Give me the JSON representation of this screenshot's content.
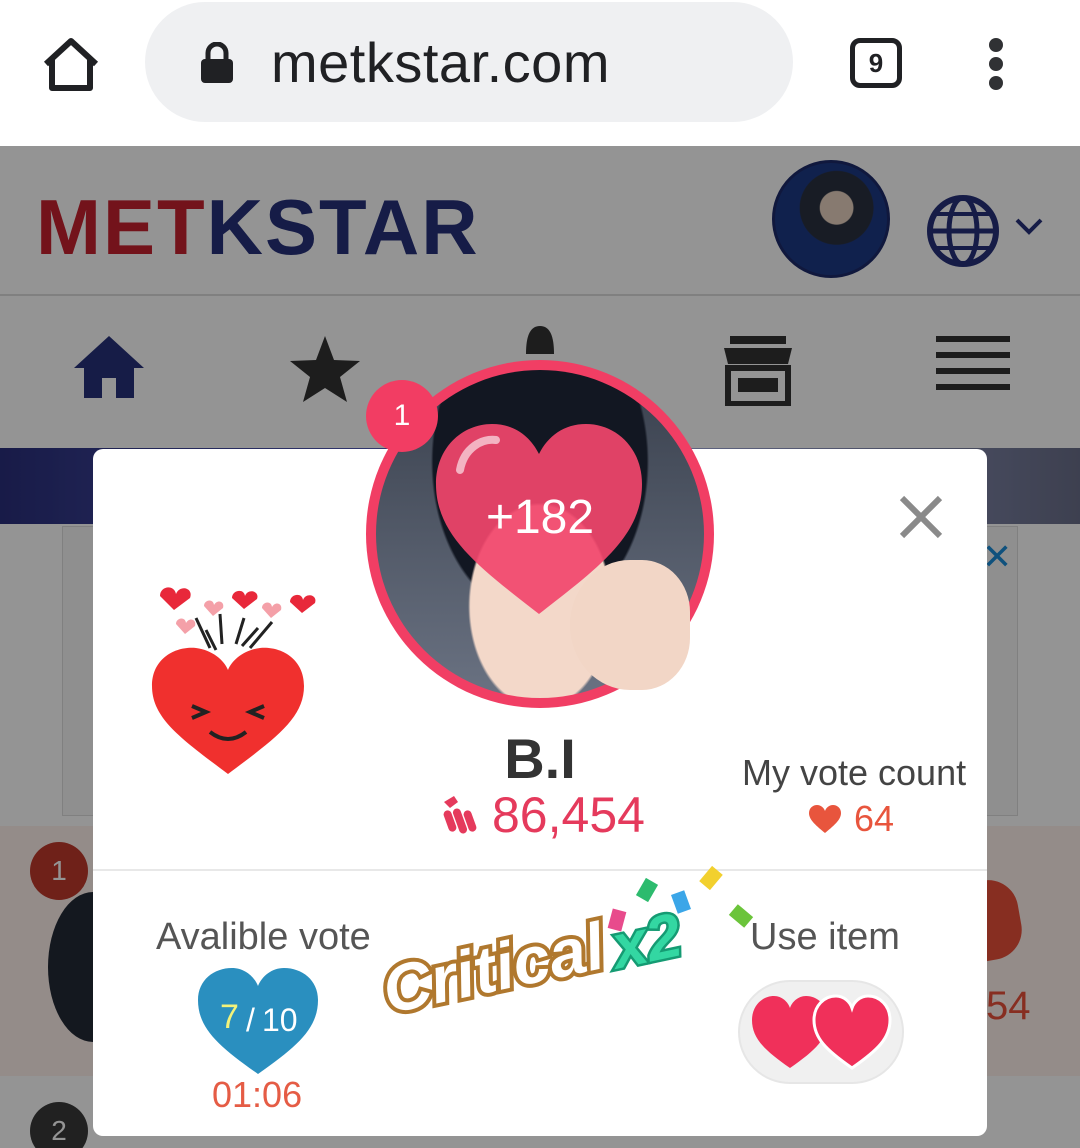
{
  "browser": {
    "url": "metkstar.com",
    "tab_count": "9"
  },
  "site": {
    "logo_prefix": "M",
    "logo_e": "E",
    "logo_t": "T",
    "logo_suffix": "KSTAR"
  },
  "background_list": {
    "rank_1": "1",
    "rank_2": "2",
    "peek_value": "54"
  },
  "modal": {
    "rank": "1",
    "vote_increment": "+182",
    "star_name": "B.I",
    "total_votes": "86,454",
    "my_vote_label": "My vote count",
    "my_vote_count": "64",
    "available_label": "Avalible vote",
    "available_current": "7",
    "available_separator": "/",
    "available_max": "10",
    "timer": "01:06",
    "critical_text": "Critical",
    "critical_multiplier": "x2",
    "use_item_label": "Use item"
  },
  "colors": {
    "accent_pink": "#f13e64",
    "vote_red": "#e53a5c",
    "timer_orange": "#e55c45",
    "available_blue": "#2a8fbf",
    "logo_red": "#c62230",
    "logo_blue": "#26317a"
  }
}
